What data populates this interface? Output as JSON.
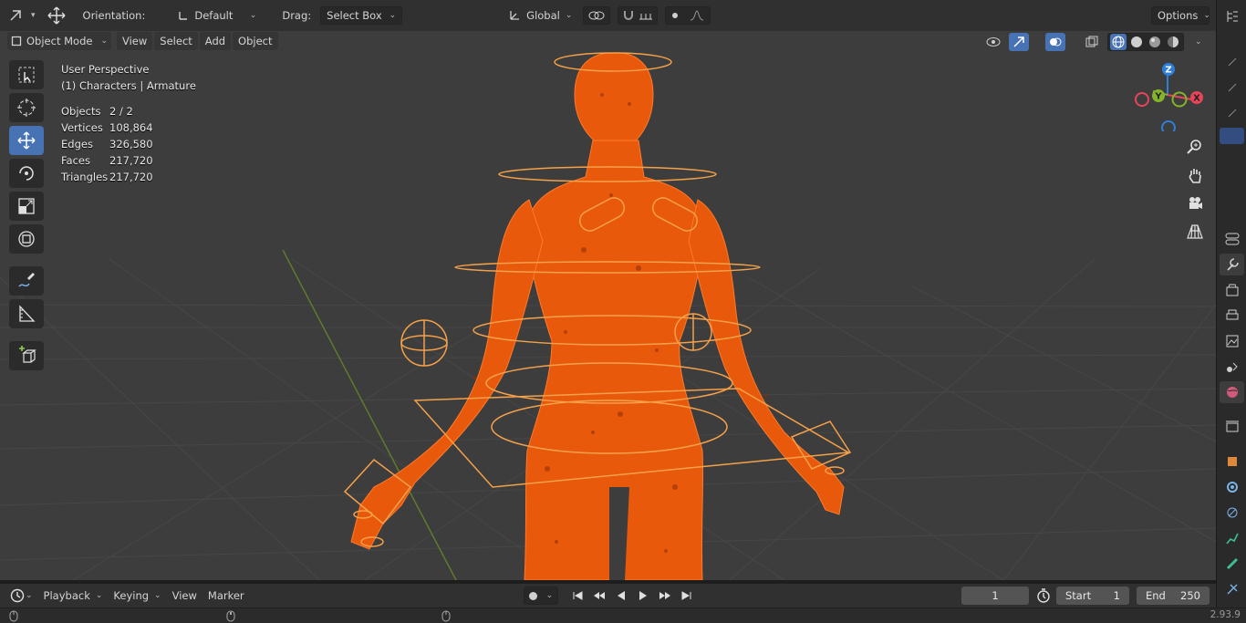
{
  "tool_header": {
    "orientation_label": "Orientation:",
    "orientation_value": "Default",
    "drag_label": "Drag:",
    "drag_value": "Select Box",
    "transform_orientation": "Global",
    "options_label": "Options"
  },
  "viewport_header": {
    "mode": "Object Mode",
    "menus": [
      "View",
      "Select",
      "Add",
      "Object"
    ]
  },
  "overlay": {
    "view_name": "User Perspective",
    "collection": "(1) Characters | Armature",
    "stats": [
      {
        "label": "Objects",
        "value": "2 / 2"
      },
      {
        "label": "Vertices",
        "value": "108,864"
      },
      {
        "label": "Edges",
        "value": "326,580"
      },
      {
        "label": "Faces",
        "value": "217,720"
      },
      {
        "label": "Triangles",
        "value": "217,720"
      }
    ]
  },
  "toolbar": {
    "tools": [
      "select-box-tool",
      "cursor-tool",
      "move-tool",
      "rotate-tool",
      "scale-tool",
      "transform-tool",
      "annotate-tool",
      "measure-tool",
      "add-cube-tool"
    ],
    "active": "move-tool"
  },
  "gizmo": {
    "z": "Z",
    "y": "Y",
    "x": "X"
  },
  "timeline": {
    "menus": [
      "Playback",
      "Keying",
      "View",
      "Marker"
    ],
    "current_frame": "1",
    "start_label": "Start",
    "start_value": "1",
    "end_label": "End",
    "end_value": "250"
  },
  "statusbar": {
    "version": "2.93.9"
  },
  "colors": {
    "accent": "#4772b3",
    "selection_orange": "#ff6a1a",
    "bone_outline": "#f5a14a",
    "axis_x": "#e8445a",
    "axis_y": "#85b32a",
    "axis_z": "#2f7ed8"
  }
}
